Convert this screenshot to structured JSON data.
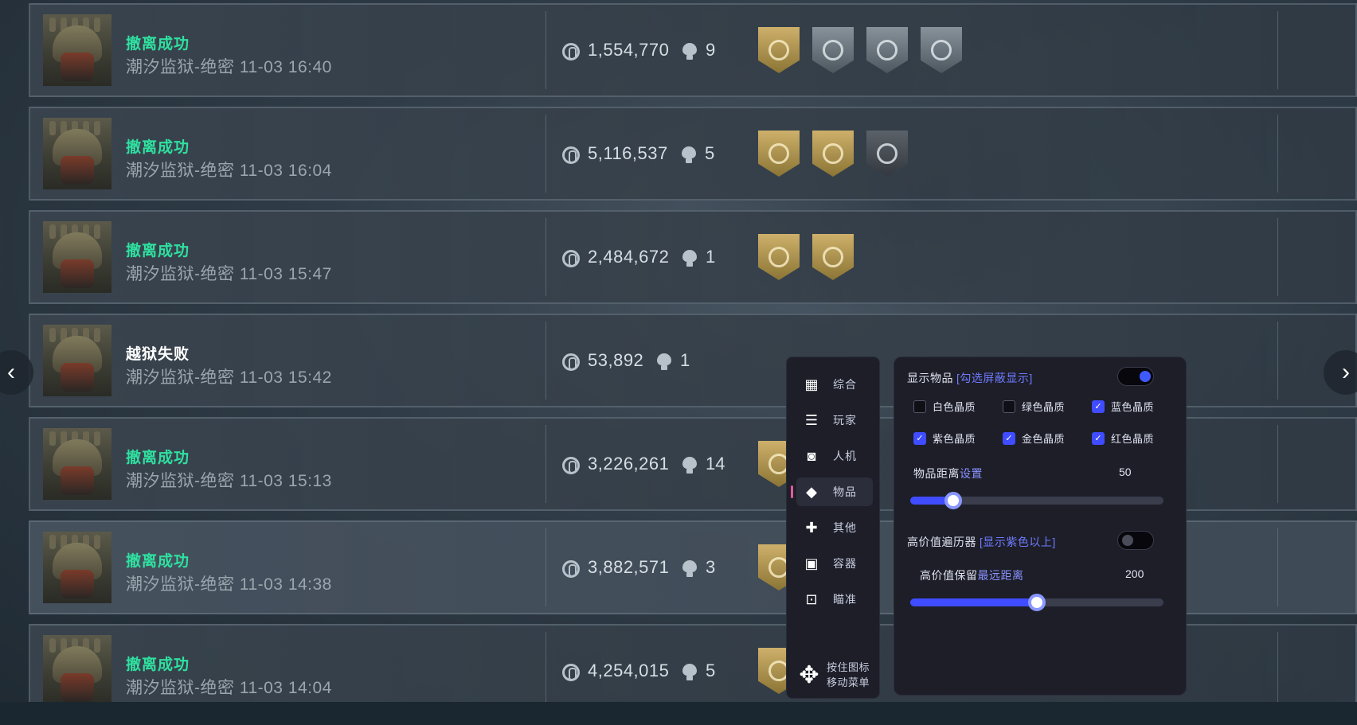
{
  "matches": [
    {
      "status": "撤离成功",
      "status_type": "ok",
      "map_time": "潮汐监狱-绝密 11-03 16:40",
      "value": "1,554,770",
      "kills": "9",
      "badges": [
        "gold",
        "silver",
        "silver",
        "silver"
      ]
    },
    {
      "status": "撤离成功",
      "status_type": "ok",
      "map_time": "潮汐监狱-绝密 11-03 16:04",
      "value": "5,116,537",
      "kills": "5",
      "badges": [
        "gold",
        "gold",
        "dark"
      ]
    },
    {
      "status": "撤离成功",
      "status_type": "ok",
      "map_time": "潮汐监狱-绝密 11-03 15:47",
      "value": "2,484,672",
      "kills": "1",
      "badges": [
        "gold",
        "gold"
      ]
    },
    {
      "status": "越狱失败",
      "status_type": "fail",
      "map_time": "潮汐监狱-绝密 11-03 15:42",
      "value": "53,892",
      "kills": "1",
      "badges": []
    },
    {
      "status": "撤离成功",
      "status_type": "ok",
      "map_time": "潮汐监狱-绝密 11-03 15:13",
      "value": "3,226,261",
      "kills": "14",
      "badges": [
        "gold"
      ]
    },
    {
      "status": "撤离成功",
      "status_type": "ok",
      "map_time": "潮汐监狱-绝密 11-03 14:38",
      "value": "3,882,571",
      "kills": "3",
      "badges": [
        "gold"
      ]
    },
    {
      "status": "撤离成功",
      "status_type": "ok",
      "map_time": "潮汐监狱-绝密 11-03 14:04",
      "value": "4,254,015",
      "kills": "5",
      "badges": [
        "gold"
      ]
    }
  ],
  "nav": {
    "prev_icon": "‹",
    "next_icon": "›"
  },
  "menu": {
    "items": [
      {
        "label": "综合",
        "icon": "grid-icon",
        "glyph": "▦",
        "active": false
      },
      {
        "label": "玩家",
        "icon": "user-list-icon",
        "glyph": "☰",
        "active": false
      },
      {
        "label": "人机",
        "icon": "robot-icon",
        "glyph": "◙",
        "active": false
      },
      {
        "label": "物品",
        "icon": "diamond-icon",
        "glyph": "◆",
        "active": true
      },
      {
        "label": "其他",
        "icon": "puzzle-icon",
        "glyph": "✚",
        "active": false
      },
      {
        "label": "容器",
        "icon": "box-icon",
        "glyph": "▣",
        "active": false
      },
      {
        "label": "瞄准",
        "icon": "crosshair-icon",
        "glyph": "⊡",
        "active": false
      }
    ],
    "move_hint_line1": "按住图标",
    "move_hint_line2": "移动菜单",
    "move_glyph": "✥"
  },
  "panel": {
    "show_items_label": "显示物品",
    "show_items_hint": "[勾选屏蔽显示]",
    "show_items_on": true,
    "qualities": [
      {
        "label": "白色晶质",
        "checked": false
      },
      {
        "label": "绿色晶质",
        "checked": false
      },
      {
        "label": "蓝色晶质",
        "checked": true
      },
      {
        "label": "紫色晶质",
        "checked": true
      },
      {
        "label": "金色晶质",
        "checked": true
      },
      {
        "label": "红色晶质",
        "checked": true
      }
    ],
    "distance_label_a": "物品距离",
    "distance_label_b": "设置",
    "distance_value": "50",
    "distance_fraction": 0.17,
    "highvalue_label": "高价值遍历器",
    "highvalue_hint": "[显示紫色以上]",
    "highvalue_on": false,
    "keep_label_a": "高价值保留",
    "keep_label_b": "最远距离",
    "keep_value": "200",
    "keep_fraction": 0.5
  },
  "colors": {
    "accent": "#3f4cff",
    "success": "#2fe0a0",
    "active_marker": "#e05aa0"
  }
}
